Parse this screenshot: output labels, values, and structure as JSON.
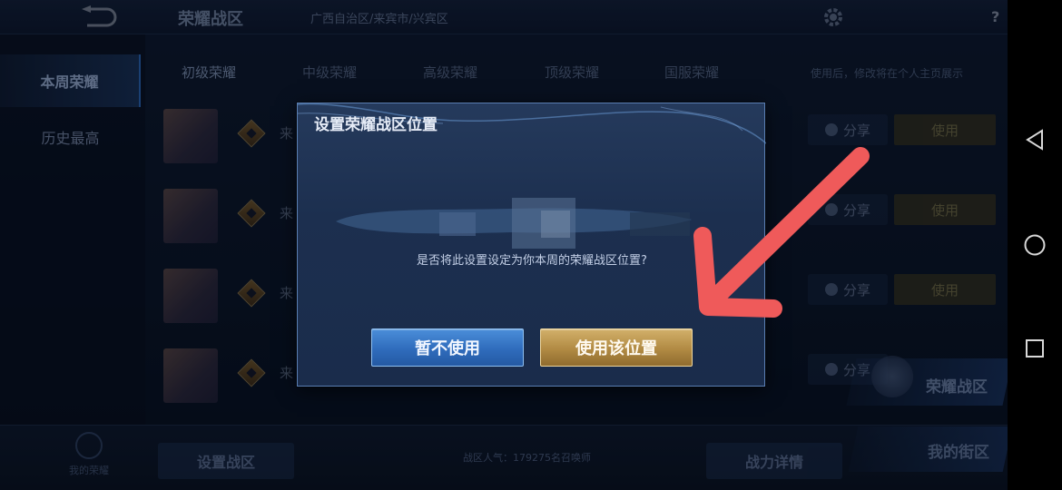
{
  "app": {
    "title": "荣耀战区",
    "subtitle": "",
    "location": "广西自治区/来宾市/兴宾区",
    "help_label": "?"
  },
  "side_tabs": [
    {
      "label": "本周荣耀",
      "active": true
    },
    {
      "label": "历史最高",
      "active": false
    }
  ],
  "rank_tabs": [
    {
      "label": "初级荣耀",
      "active": true
    },
    {
      "label": "中级荣耀",
      "active": false
    },
    {
      "label": "高级荣耀",
      "active": false
    },
    {
      "label": "顶级荣耀",
      "active": false
    },
    {
      "label": "国服荣耀",
      "active": false
    }
  ],
  "rank_hint": "使用后，修改将在个人主页展示",
  "rows": [
    {
      "text": "来",
      "share_label": "分享",
      "use_label": "使用"
    },
    {
      "text": "来",
      "share_label": "分享",
      "use_label": "使用"
    },
    {
      "text": "来",
      "share_label": "分享",
      "use_label": "使用"
    },
    {
      "text": "来",
      "share_label": "分享",
      "use_label": ""
    }
  ],
  "glory_zone_label": "荣耀战区",
  "bottom": {
    "my_glory_label": "我的荣耀",
    "set_zone_label": "设置战区",
    "popularity_text": "战区人气：179275名召唤师",
    "power_detail_label": "战力详情",
    "my_street_label": "我的街区"
  },
  "dialog": {
    "title": "设置荣耀战区位置",
    "message": "是否将此设置设定为你本周的荣耀战区位置?",
    "cancel_label": "暂不使用",
    "confirm_label": "使用该位置"
  },
  "colors": {
    "dialog_border": "#5a7fb4",
    "cancel_button": "#2f6cbc",
    "confirm_button": "#b18a43",
    "annotation_arrow": "#ef5a5a"
  },
  "icons": {
    "back": "back-arrow-icon",
    "settings": "gear-icon",
    "nav_back": "triangle-back-icon",
    "nav_home": "circle-home-icon",
    "nav_recents": "square-recents-icon"
  }
}
